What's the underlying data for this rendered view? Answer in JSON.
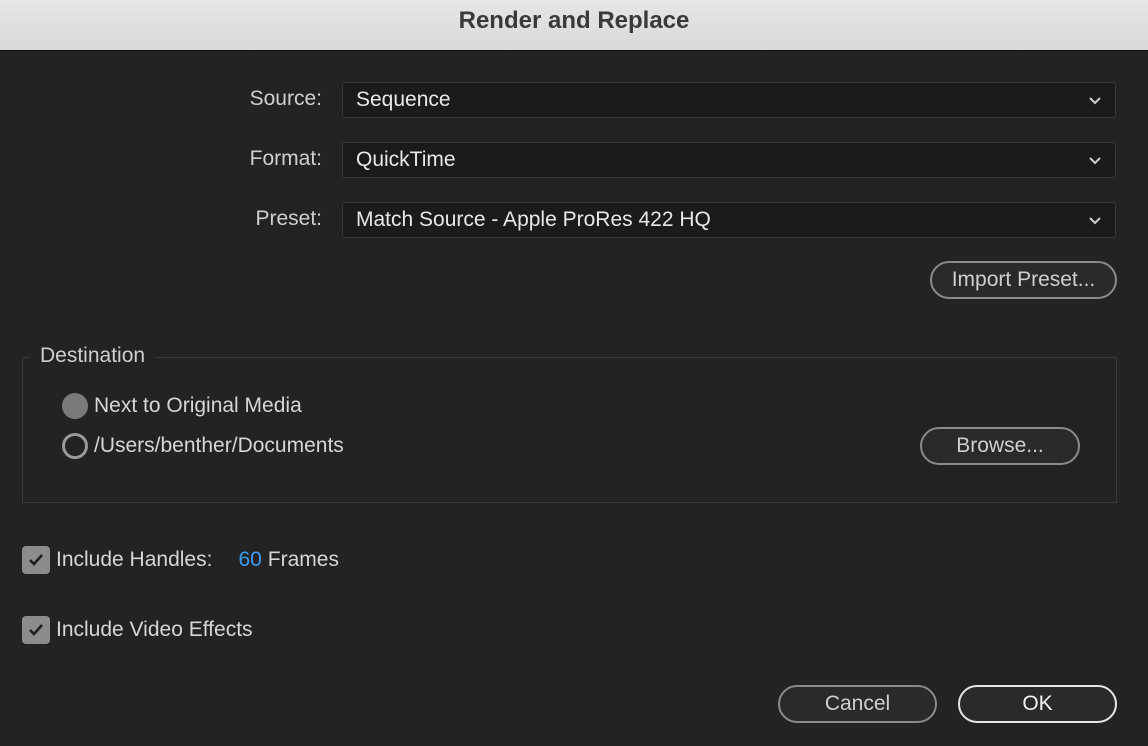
{
  "window": {
    "title": "Render and Replace"
  },
  "source": {
    "label": "Source:",
    "value": "Sequence"
  },
  "format": {
    "label": "Format:",
    "value": "QuickTime"
  },
  "preset": {
    "label": "Preset:",
    "value": "Match Source - Apple ProRes 422 HQ"
  },
  "import_preset_label": "Import Preset...",
  "destination": {
    "legend": "Destination",
    "options": [
      {
        "label": "Next to Original Media",
        "selected": true
      },
      {
        "label": "/Users/benther/Documents",
        "selected": false
      }
    ],
    "browse_label": "Browse..."
  },
  "handles": {
    "label": "Include Handles:",
    "checked": true,
    "value": "60",
    "unit": "Frames"
  },
  "video_effects": {
    "label": "Include Video Effects",
    "checked": true
  },
  "buttons": {
    "cancel": "Cancel",
    "ok": "OK"
  },
  "colors": {
    "accent_value": "#3c9df0",
    "background": "#232323",
    "titlebar": "#dedede"
  }
}
